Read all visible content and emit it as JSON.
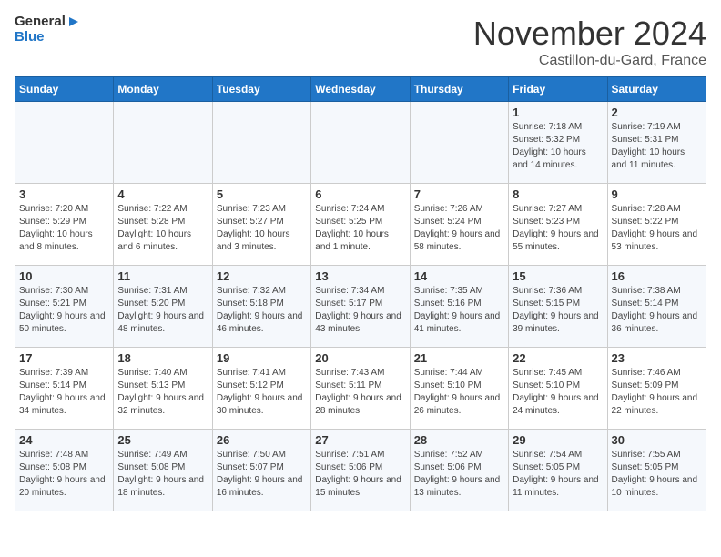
{
  "header": {
    "logo_general": "General",
    "logo_blue": "Blue",
    "month_title": "November 2024",
    "location": "Castillon-du-Gard, France"
  },
  "weekdays": [
    "Sunday",
    "Monday",
    "Tuesday",
    "Wednesday",
    "Thursday",
    "Friday",
    "Saturday"
  ],
  "weeks": [
    [
      {
        "day": "",
        "info": ""
      },
      {
        "day": "",
        "info": ""
      },
      {
        "day": "",
        "info": ""
      },
      {
        "day": "",
        "info": ""
      },
      {
        "day": "",
        "info": ""
      },
      {
        "day": "1",
        "info": "Sunrise: 7:18 AM\nSunset: 5:32 PM\nDaylight: 10 hours and 14 minutes."
      },
      {
        "day": "2",
        "info": "Sunrise: 7:19 AM\nSunset: 5:31 PM\nDaylight: 10 hours and 11 minutes."
      }
    ],
    [
      {
        "day": "3",
        "info": "Sunrise: 7:20 AM\nSunset: 5:29 PM\nDaylight: 10 hours and 8 minutes."
      },
      {
        "day": "4",
        "info": "Sunrise: 7:22 AM\nSunset: 5:28 PM\nDaylight: 10 hours and 6 minutes."
      },
      {
        "day": "5",
        "info": "Sunrise: 7:23 AM\nSunset: 5:27 PM\nDaylight: 10 hours and 3 minutes."
      },
      {
        "day": "6",
        "info": "Sunrise: 7:24 AM\nSunset: 5:25 PM\nDaylight: 10 hours and 1 minute."
      },
      {
        "day": "7",
        "info": "Sunrise: 7:26 AM\nSunset: 5:24 PM\nDaylight: 9 hours and 58 minutes."
      },
      {
        "day": "8",
        "info": "Sunrise: 7:27 AM\nSunset: 5:23 PM\nDaylight: 9 hours and 55 minutes."
      },
      {
        "day": "9",
        "info": "Sunrise: 7:28 AM\nSunset: 5:22 PM\nDaylight: 9 hours and 53 minutes."
      }
    ],
    [
      {
        "day": "10",
        "info": "Sunrise: 7:30 AM\nSunset: 5:21 PM\nDaylight: 9 hours and 50 minutes."
      },
      {
        "day": "11",
        "info": "Sunrise: 7:31 AM\nSunset: 5:20 PM\nDaylight: 9 hours and 48 minutes."
      },
      {
        "day": "12",
        "info": "Sunrise: 7:32 AM\nSunset: 5:18 PM\nDaylight: 9 hours and 46 minutes."
      },
      {
        "day": "13",
        "info": "Sunrise: 7:34 AM\nSunset: 5:17 PM\nDaylight: 9 hours and 43 minutes."
      },
      {
        "day": "14",
        "info": "Sunrise: 7:35 AM\nSunset: 5:16 PM\nDaylight: 9 hours and 41 minutes."
      },
      {
        "day": "15",
        "info": "Sunrise: 7:36 AM\nSunset: 5:15 PM\nDaylight: 9 hours and 39 minutes."
      },
      {
        "day": "16",
        "info": "Sunrise: 7:38 AM\nSunset: 5:14 PM\nDaylight: 9 hours and 36 minutes."
      }
    ],
    [
      {
        "day": "17",
        "info": "Sunrise: 7:39 AM\nSunset: 5:14 PM\nDaylight: 9 hours and 34 minutes."
      },
      {
        "day": "18",
        "info": "Sunrise: 7:40 AM\nSunset: 5:13 PM\nDaylight: 9 hours and 32 minutes."
      },
      {
        "day": "19",
        "info": "Sunrise: 7:41 AM\nSunset: 5:12 PM\nDaylight: 9 hours and 30 minutes."
      },
      {
        "day": "20",
        "info": "Sunrise: 7:43 AM\nSunset: 5:11 PM\nDaylight: 9 hours and 28 minutes."
      },
      {
        "day": "21",
        "info": "Sunrise: 7:44 AM\nSunset: 5:10 PM\nDaylight: 9 hours and 26 minutes."
      },
      {
        "day": "22",
        "info": "Sunrise: 7:45 AM\nSunset: 5:10 PM\nDaylight: 9 hours and 24 minutes."
      },
      {
        "day": "23",
        "info": "Sunrise: 7:46 AM\nSunset: 5:09 PM\nDaylight: 9 hours and 22 minutes."
      }
    ],
    [
      {
        "day": "24",
        "info": "Sunrise: 7:48 AM\nSunset: 5:08 PM\nDaylight: 9 hours and 20 minutes."
      },
      {
        "day": "25",
        "info": "Sunrise: 7:49 AM\nSunset: 5:08 PM\nDaylight: 9 hours and 18 minutes."
      },
      {
        "day": "26",
        "info": "Sunrise: 7:50 AM\nSunset: 5:07 PM\nDaylight: 9 hours and 16 minutes."
      },
      {
        "day": "27",
        "info": "Sunrise: 7:51 AM\nSunset: 5:06 PM\nDaylight: 9 hours and 15 minutes."
      },
      {
        "day": "28",
        "info": "Sunrise: 7:52 AM\nSunset: 5:06 PM\nDaylight: 9 hours and 13 minutes."
      },
      {
        "day": "29",
        "info": "Sunrise: 7:54 AM\nSunset: 5:05 PM\nDaylight: 9 hours and 11 minutes."
      },
      {
        "day": "30",
        "info": "Sunrise: 7:55 AM\nSunset: 5:05 PM\nDaylight: 9 hours and 10 minutes."
      }
    ]
  ]
}
